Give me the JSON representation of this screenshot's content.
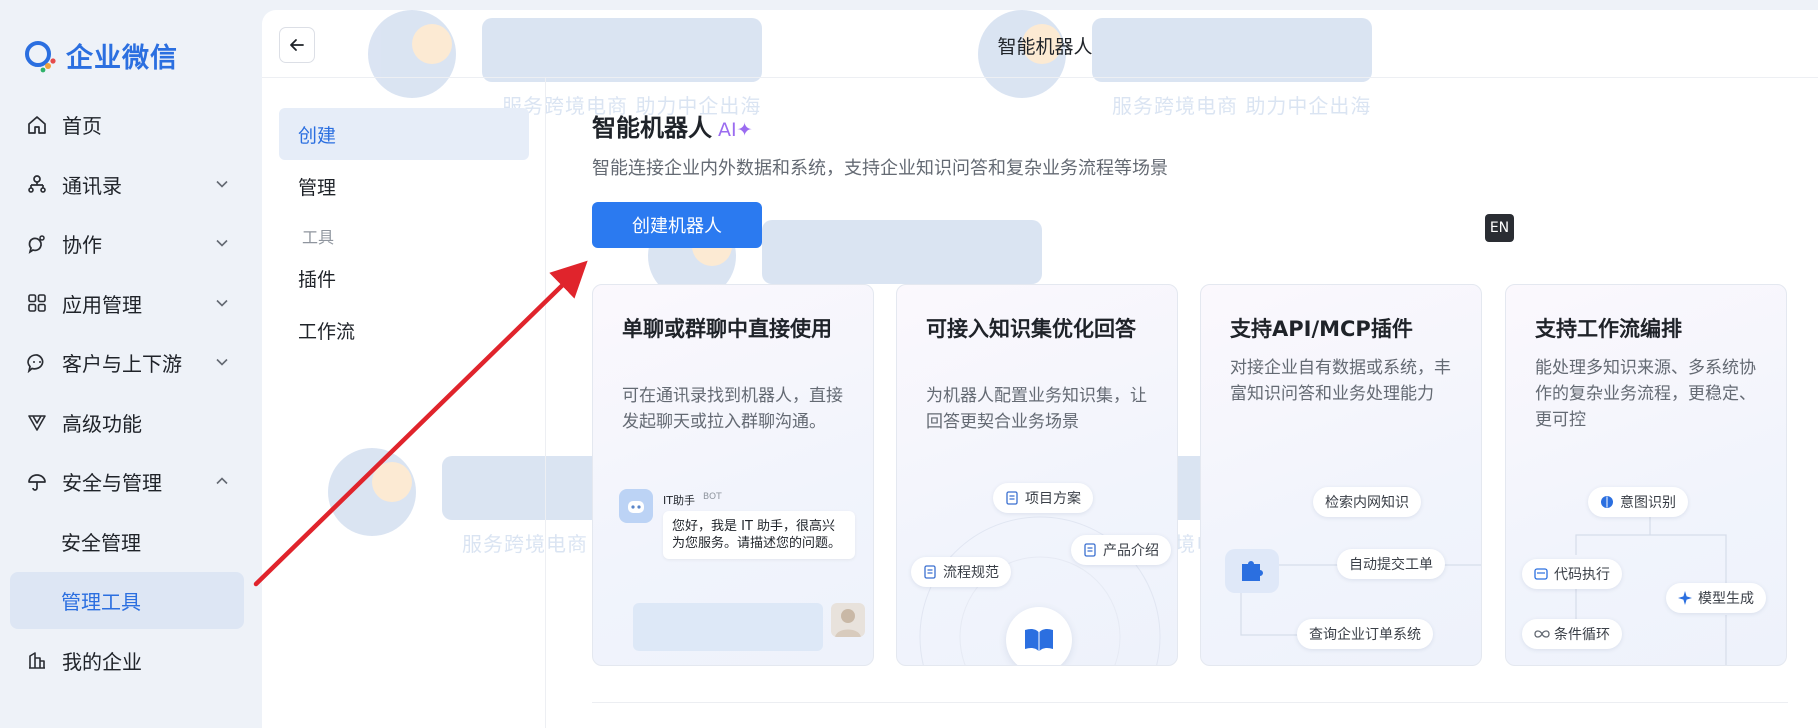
{
  "app": {
    "logo_text": "企业微信"
  },
  "sidebar": {
    "items": [
      {
        "label": "首页",
        "icon": "home-icon",
        "has_chevron": false,
        "expanded": false
      },
      {
        "label": "通讯录",
        "icon": "contacts-icon",
        "has_chevron": true,
        "expanded": false
      },
      {
        "label": "协作",
        "icon": "collaboration-icon",
        "has_chevron": true,
        "expanded": false
      },
      {
        "label": "应用管理",
        "icon": "apps-grid-icon",
        "has_chevron": true,
        "expanded": false
      },
      {
        "label": "客户与上下游",
        "icon": "chat-bubble-icon",
        "has_chevron": true,
        "expanded": false
      },
      {
        "label": "高级功能",
        "icon": "diamond-icon",
        "has_chevron": false,
        "expanded": false
      },
      {
        "label": "安全与管理",
        "icon": "umbrella-icon",
        "has_chevron": true,
        "expanded": true
      },
      {
        "label": "安全管理",
        "sub": true
      },
      {
        "label": "管理工具",
        "sub": true,
        "active": true
      },
      {
        "label": "我的企业",
        "icon": "building-icon",
        "has_chevron": false,
        "expanded": false
      }
    ]
  },
  "topbar": {
    "title": "智能机器人"
  },
  "subnav": {
    "create": "创建",
    "manage": "管理",
    "section_tools": "工具",
    "plugins": "插件",
    "workflow": "工作流"
  },
  "content": {
    "title": "智能机器人",
    "ai_tag": "AI✦",
    "description": "智能连接企业内外数据和系统，支持企业知识问答和复杂业务流程等场景",
    "create_button": "创建机器人",
    "lang_badge": "EN"
  },
  "cards": [
    {
      "title": "单聊或群聊中直接使用",
      "description": "可在通讯录找到机器人，直接发起聊天或拉入群聊沟通。",
      "chat": {
        "name": "IT助手",
        "tag": "BOT",
        "message": "您好，我是 IT 助手，很高兴为您服务。请描述您的问题。"
      }
    },
    {
      "title": "可接入知识集优化回答",
      "description": "为机器人配置业务知识集，让回答更契合业务场景",
      "pills": [
        "项目方案",
        "产品介绍",
        "流程规范"
      ]
    },
    {
      "title": "支持API/MCP插件",
      "description": "对接企业自有数据或系统，丰富知识问答和业务处理能力",
      "pills": [
        "检索内网知识",
        "自动提交工单",
        "查询企业订单系统"
      ]
    },
    {
      "title": "支持工作流编排",
      "description": "能处理多知识来源、多系统协作的复杂业务流程，更稳定、更可控",
      "pills": [
        "意图识别",
        "代码执行",
        "模型生成",
        "条件循环"
      ]
    }
  ],
  "watermark": {
    "text": "服务跨境电商 助力中企出海"
  },
  "colors": {
    "accent": "#2b7af0",
    "active_bg": "#dde6f4",
    "arrow": "#e0242c",
    "ai_tag": "#9b6cf0"
  }
}
